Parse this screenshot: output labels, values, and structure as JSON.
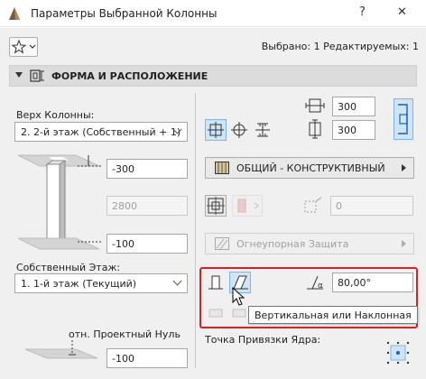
{
  "window": {
    "title": "Параметры Выбранной Колонны",
    "help_glyph": "?",
    "close_glyph": "✕"
  },
  "header": {
    "selected_info": "Выбрано: 1 Редактируемых: 1"
  },
  "section": {
    "title": "ФОРМА И РАСПОЛОЖЕНИЕ"
  },
  "left": {
    "top_label": "Верх Колонны:",
    "top_value": "2. 2-й этаж (Собственный + 1)",
    "top_offset": "-300",
    "height_value": "2800",
    "bottom_offset": "-100",
    "home_story_label": "Собственный Этаж:",
    "home_story_value": "1. 1-й этаж (Текущий)",
    "ref_label": "отн. Проектный Нуль",
    "ref_value": "-100"
  },
  "right": {
    "width_value": "300",
    "depth_value": "300",
    "material_label": "ОБЩИЙ - КОНСТРУКТИВНЫЙ",
    "angle_value": "0",
    "fire_label": "Огнеупорная Защита",
    "slant_value": "80,00°",
    "tooltip": "Вертикальная или Наклонная",
    "anchor_label": "Точка Привязки Ядра:"
  },
  "icons": {
    "app": "archicad-icon",
    "favorites": "star-icon",
    "section": "column-layout-icon"
  },
  "colors": {
    "highlight": "#e02020",
    "active_bg": "#cde5f7",
    "active_border": "#7eb4ea"
  }
}
